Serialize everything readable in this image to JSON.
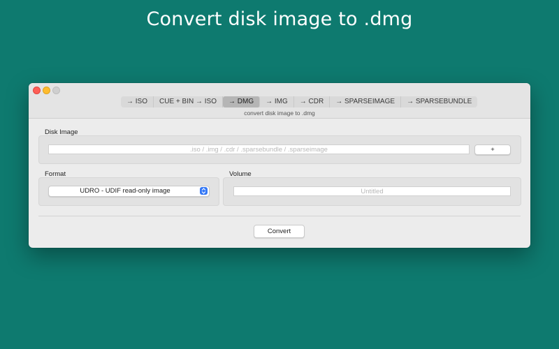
{
  "headline": "Convert disk image to .dmg",
  "window": {
    "tabs": [
      {
        "label": "→ ISO",
        "active": false
      },
      {
        "label": "CUE + BIN → ISO",
        "active": false
      },
      {
        "label": "→ DMG",
        "active": true
      },
      {
        "label": "→ IMG",
        "active": false
      },
      {
        "label": "→ CDR",
        "active": false
      },
      {
        "label": "→ SPARSEIMAGE",
        "active": false
      },
      {
        "label": "→ SPARSEBUNDLE",
        "active": false
      }
    ],
    "subtitle": "convert disk image to .dmg",
    "disk_image": {
      "label": "Disk Image",
      "placeholder": ".iso / .img / .cdr / .sparsebundle / .sparseimage",
      "add_button": "+"
    },
    "format": {
      "label": "Format",
      "selected": "UDRO - UDIF read-only image"
    },
    "volume": {
      "label": "Volume",
      "placeholder": "Untitled"
    },
    "convert_button": "Convert"
  },
  "colors": {
    "background": "#0e7a6f",
    "accent": "#3478f6"
  }
}
